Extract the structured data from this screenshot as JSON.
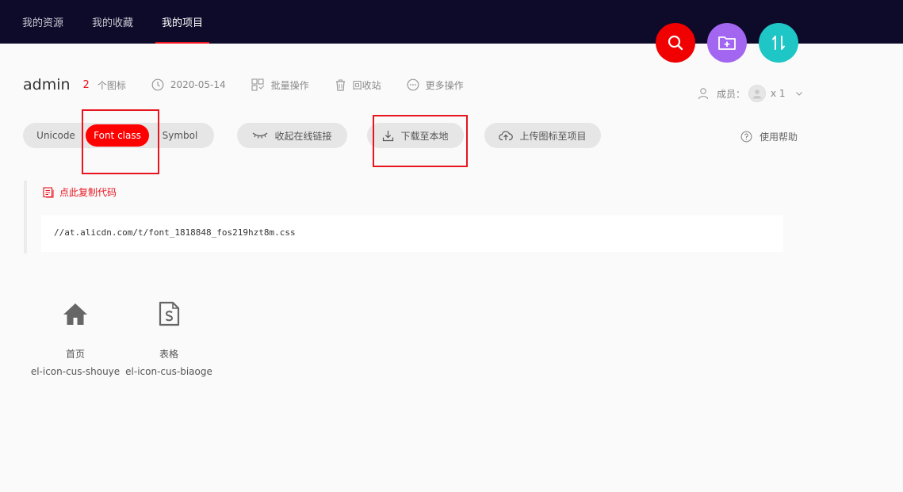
{
  "nav": {
    "tabs": [
      {
        "label": "我的资源"
      },
      {
        "label": "我的收藏"
      },
      {
        "label": "我的项目"
      }
    ]
  },
  "actions": {
    "search_color": "#f00000",
    "folder_color": "#a266f0",
    "sort_color": "#1fc6c6"
  },
  "project": {
    "name": "admin",
    "icon_count": "2",
    "icon_count_label": "个图标",
    "date": "2020-05-14",
    "batch_label": "批量操作",
    "recycle_label": "回收站",
    "more_label": "更多操作",
    "members_label": "成员：",
    "members_count": "x 1"
  },
  "toolbar": {
    "unicode_label": "Unicode",
    "fontclass_label": "Font class",
    "symbol_label": "Symbol",
    "collapse_label": "收起在线链接",
    "download_label": "下载至本地",
    "upload_label": "上传图标至项目",
    "help_label": "使用帮助"
  },
  "code": {
    "copy_label": "点此复制代码",
    "url": "//at.alicdn.com/t/font_1818848_fos219hzt8m.css"
  },
  "icons": [
    {
      "name": "首页",
      "class": "el-icon-cus-shouye",
      "glyph": "home-icon"
    },
    {
      "name": "表格",
      "class": "el-icon-cus-biaoge",
      "glyph": "file-s-icon"
    }
  ],
  "colors": {
    "topbar": "#0e0a2a",
    "accent": "#f00000",
    "highlight": "#e8141e"
  }
}
